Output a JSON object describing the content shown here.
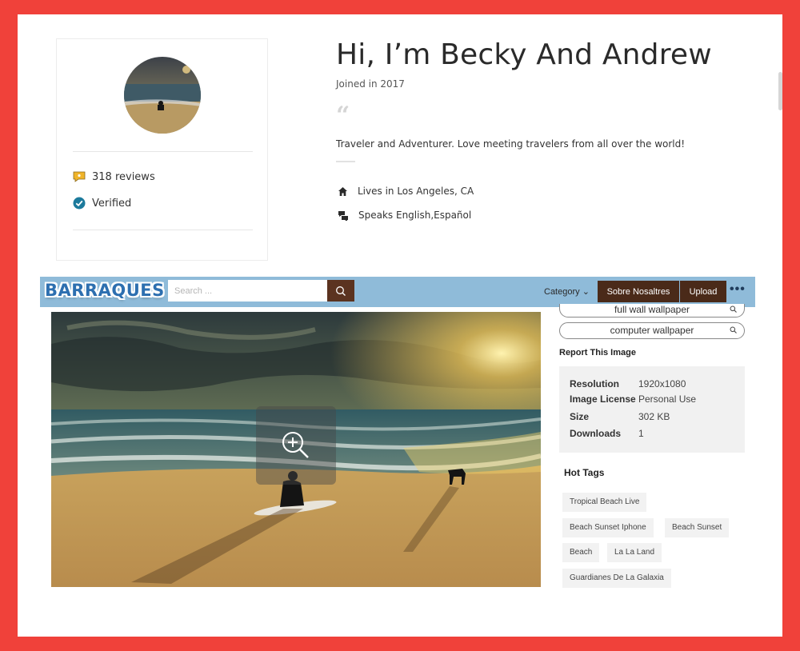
{
  "profile": {
    "name": "Hi, I’m Becky And Andrew",
    "joined": "Joined in 2017",
    "bio": "Traveler and Adventurer. Love meeting travelers from all over the world!",
    "reviews": "318 reviews",
    "verified": "Verified",
    "lives_in": "Lives in Los Angeles, CA",
    "speaks": "Speaks English,Español",
    "icons": {
      "reviews": "speech-bubble-icon",
      "verified": "check-circle-icon",
      "lives": "home-icon",
      "speaks": "chat-bubbles-icon",
      "quote": "quote-icon"
    }
  },
  "site": {
    "brand": "BARRAQUES",
    "search_placeholder": "Search ...",
    "category_label": "Category ⌄",
    "about_label": "Sobre Nosaltres",
    "upload_label": "Upload",
    "more_label": "•••",
    "colors": {
      "navbar": "#8fbbd9",
      "button": "#4a2a19",
      "brand": "#2d6fb0"
    }
  },
  "sidebar": {
    "pills": [
      "full wall wallpaper",
      "computer wallpaper"
    ],
    "report": "Report This Image",
    "info": [
      {
        "label": "Resolution",
        "value": "1920x1080"
      },
      {
        "label": "Image License",
        "value": "Personal Use"
      },
      {
        "label": "Size",
        "value": "302 KB"
      },
      {
        "label": "Downloads",
        "value": "1"
      }
    ],
    "hot_title": "Hot Tags",
    "hot_tags": [
      "Tropical Beach Live",
      "Beach Sunset Iphone",
      "Beach Sunset",
      "Beach",
      "La La Land",
      "Guardianes De La Galaxia"
    ]
  }
}
